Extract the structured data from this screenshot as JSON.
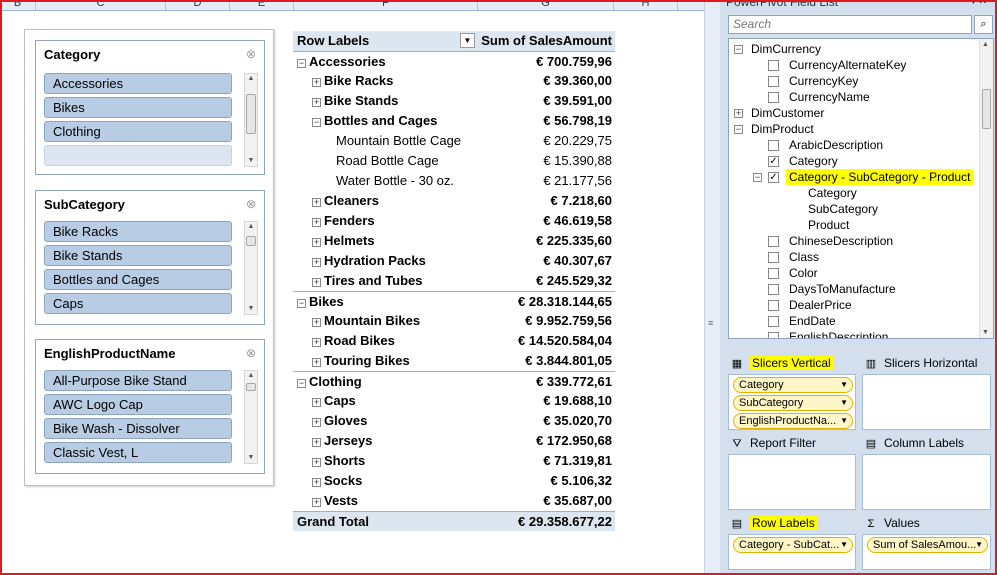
{
  "columns": [
    "B",
    "C",
    "D",
    "E",
    "F",
    "G",
    "H"
  ],
  "slicers": [
    {
      "title": "Category",
      "items": [
        "Accessories",
        "Bikes",
        "Clothing",
        ""
      ]
    },
    {
      "title": "SubCategory",
      "items": [
        "Bike Racks",
        "Bike Stands",
        "Bottles and Cages",
        "Caps"
      ]
    },
    {
      "title": "EnglishProductName",
      "items": [
        "All-Purpose Bike Stand",
        "AWC Logo Cap",
        "Bike Wash - Dissolver",
        "Classic Vest, L"
      ]
    }
  ],
  "pivot": {
    "header_label": "Row Labels",
    "header_value": "Sum of SalesAmount",
    "rows": [
      {
        "label": "Accessories",
        "value": "€ 700.759,96"
      },
      {
        "label": "Bike Racks",
        "value": "€ 39.360,00"
      },
      {
        "label": "Bike Stands",
        "value": "€ 39.591,00"
      },
      {
        "label": "Bottles and Cages",
        "value": "€ 56.798,19"
      },
      {
        "label": "Mountain Bottle Cage",
        "value": "€ 20.229,75"
      },
      {
        "label": "Road Bottle Cage",
        "value": "€ 15.390,88"
      },
      {
        "label": "Water Bottle - 30 oz.",
        "value": "€ 21.177,56"
      },
      {
        "label": "Cleaners",
        "value": "€ 7.218,60"
      },
      {
        "label": "Fenders",
        "value": "€ 46.619,58"
      },
      {
        "label": "Helmets",
        "value": "€ 225.335,60"
      },
      {
        "label": "Hydration Packs",
        "value": "€ 40.307,67"
      },
      {
        "label": "Tires and Tubes",
        "value": "€ 245.529,32"
      },
      {
        "label": "Bikes",
        "value": "€ 28.318.144,65"
      },
      {
        "label": "Mountain Bikes",
        "value": "€ 9.952.759,56"
      },
      {
        "label": "Road Bikes",
        "value": "€ 14.520.584,04"
      },
      {
        "label": "Touring Bikes",
        "value": "€ 3.844.801,05"
      },
      {
        "label": "Clothing",
        "value": "€ 339.772,61"
      },
      {
        "label": "Caps",
        "value": "€ 19.688,10"
      },
      {
        "label": "Gloves",
        "value": "€ 35.020,70"
      },
      {
        "label": "Jerseys",
        "value": "€ 172.950,68"
      },
      {
        "label": "Shorts",
        "value": "€ 71.319,81"
      },
      {
        "label": "Socks",
        "value": "€ 5.106,32"
      },
      {
        "label": "Vests",
        "value": "€ 35.687,00"
      }
    ],
    "grand_total_label": "Grand Total",
    "grand_total_value": "€ 29.358.677,22"
  },
  "field_list": {
    "title": "PowerPivot Field List",
    "search_placeholder": "Search",
    "tree": [
      {
        "label": "DimCurrency"
      },
      {
        "label": "CurrencyAlternateKey",
        "checked": false
      },
      {
        "label": "CurrencyKey",
        "checked": false
      },
      {
        "label": "CurrencyName",
        "checked": false
      },
      {
        "label": "DimCustomer"
      },
      {
        "label": "DimProduct"
      },
      {
        "label": "ArabicDescription",
        "checked": false
      },
      {
        "label": "Category",
        "checked": true
      },
      {
        "label": "Category - SubCategory - Product",
        "checked": true
      },
      {
        "label": "Category"
      },
      {
        "label": "SubCategory"
      },
      {
        "label": "Product"
      },
      {
        "label": "ChineseDescription",
        "checked": false
      },
      {
        "label": "Class",
        "checked": false
      },
      {
        "label": "Color",
        "checked": false
      },
      {
        "label": "DaysToManufacture",
        "checked": false
      },
      {
        "label": "DealerPrice",
        "checked": false
      },
      {
        "label": "EndDate",
        "checked": false
      },
      {
        "label": "EnglishDescription",
        "checked": false
      }
    ],
    "zones": {
      "slicers_vertical": {
        "label": "Slicers Vertical",
        "fields": [
          "Category",
          "SubCategory",
          "EnglishProductNa..."
        ]
      },
      "slicers_horizontal": {
        "label": "Slicers Horizontal"
      },
      "report_filter": {
        "label": "Report Filter"
      },
      "column_labels": {
        "label": "Column Labels"
      },
      "row_labels": {
        "label": "Row Labels",
        "fields": [
          "Category - SubCat..."
        ]
      },
      "values": {
        "label": "Values",
        "fields": [
          "Sum of SalesAmou..."
        ]
      }
    }
  },
  "colors": {
    "highlight": "#ffff00",
    "slicer_item": "#b8cce4",
    "frame": "#e0191f"
  }
}
